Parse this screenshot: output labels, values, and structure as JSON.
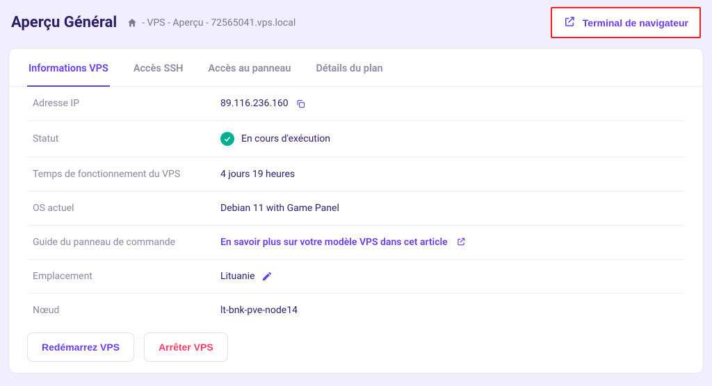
{
  "header": {
    "title": "Aperçu Général",
    "breadcrumb_text": "- VPS - Aperçu - 72565041.vps.local",
    "terminal_label": "Terminal de navigateur"
  },
  "tabs": [
    {
      "label": "Informations VPS",
      "active": true
    },
    {
      "label": "Accès SSH",
      "active": false
    },
    {
      "label": "Accès au panneau",
      "active": false
    },
    {
      "label": "Détails du plan",
      "active": false
    }
  ],
  "info": {
    "ip_label": "Adresse IP",
    "ip_value": "89.116.236.160",
    "status_label": "Statut",
    "status_value": "En cours d'exécution",
    "uptime_label": "Temps de fonctionnement du VPS",
    "uptime_value": "4 jours 19 heures",
    "os_label": "OS actuel",
    "os_value": "Debian 11 with Game Panel",
    "guide_label": "Guide du panneau de commande",
    "guide_value": "En savoir plus sur votre modèle VPS dans cet article",
    "location_label": "Emplacement",
    "location_value": "Lituanie",
    "node_label": "Nœud",
    "node_value": "lt-bnk-pve-node14"
  },
  "actions": {
    "restart_label": "Redémarrez VPS",
    "stop_label": "Arrêter VPS"
  }
}
